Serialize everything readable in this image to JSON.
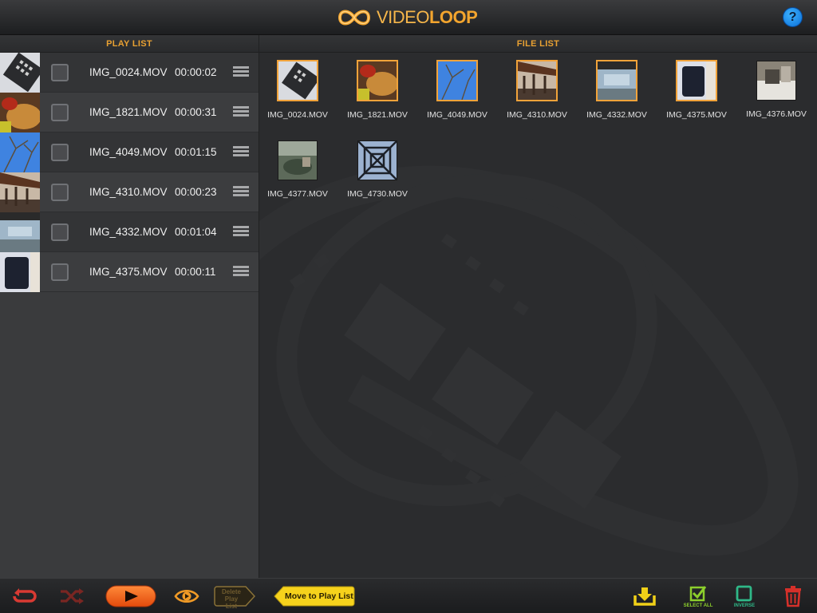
{
  "app": {
    "logo_text_light": "VIDEO",
    "logo_text_bold": "LOOP",
    "help_label": "?",
    "accent": "#f1a33a"
  },
  "sections": {
    "playlist_title": "PLAY LIST",
    "filelist_title": "FILE LIST"
  },
  "playlist": {
    "items": [
      {
        "name": "IMG_0024.MOV",
        "duration": "00:00:02",
        "checked": false
      },
      {
        "name": "IMG_1821.MOV",
        "duration": "00:00:31",
        "checked": false
      },
      {
        "name": "IMG_4049.MOV",
        "duration": "00:01:15",
        "checked": false
      },
      {
        "name": "IMG_4310.MOV",
        "duration": "00:00:23",
        "checked": false
      },
      {
        "name": "IMG_4332.MOV",
        "duration": "00:01:04",
        "checked": false
      },
      {
        "name": "IMG_4375.MOV",
        "duration": "00:00:11",
        "checked": false
      }
    ]
  },
  "filelist": {
    "items": [
      {
        "name": "IMG_0024.MOV",
        "selected": true
      },
      {
        "name": "IMG_1821.MOV",
        "selected": true
      },
      {
        "name": "IMG_4049.MOV",
        "selected": true
      },
      {
        "name": "IMG_4310.MOV",
        "selected": true
      },
      {
        "name": "IMG_4332.MOV",
        "selected": true
      },
      {
        "name": "IMG_4375.MOV",
        "selected": true
      },
      {
        "name": "IMG_4376.MOV",
        "selected": false
      },
      {
        "name": "IMG_4377.MOV",
        "selected": false
      },
      {
        "name": "IMG_4730.MOV",
        "selected": false
      }
    ]
  },
  "toolbar": {
    "delete_playlist_label": "Delete Play List",
    "move_to_playlist_label": "Move to Play List",
    "select_all_label": "SELECT ALL",
    "inverse_label": "INVERSE",
    "icons": [
      "loop-icon",
      "shuffle-icon",
      "play-icon",
      "eye-icon",
      "import-icon",
      "select-all-icon",
      "inverse-icon",
      "trash-icon"
    ]
  }
}
